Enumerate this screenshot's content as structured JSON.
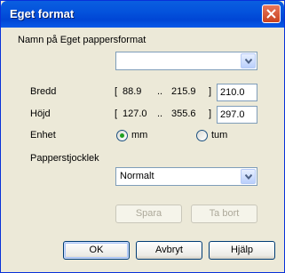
{
  "window": {
    "title": "Eget format"
  },
  "form": {
    "name_label": "Namn på Eget pappersformat",
    "name_value": "",
    "width": {
      "label": "Bredd",
      "range_open": "[",
      "min": "88.9",
      "sep": "..",
      "max": "215.9",
      "range_close": "]",
      "value": "210.0"
    },
    "height": {
      "label": "Höjd",
      "range_open": "[",
      "min": "127.0",
      "sep": "..",
      "max": "355.6",
      "range_close": "]",
      "value": "297.0"
    },
    "unit": {
      "label": "Enhet",
      "options": [
        "mm",
        "tum"
      ],
      "selected": "mm"
    },
    "thickness": {
      "label": "Papperstjocklek",
      "value": "Normalt"
    }
  },
  "buttons": {
    "save": "Spara",
    "delete": "Ta bort",
    "ok": "OK",
    "cancel": "Avbryt",
    "help": "Hjälp"
  },
  "icons": {
    "close": "close-icon",
    "dropdown": "chevron-down-icon"
  }
}
